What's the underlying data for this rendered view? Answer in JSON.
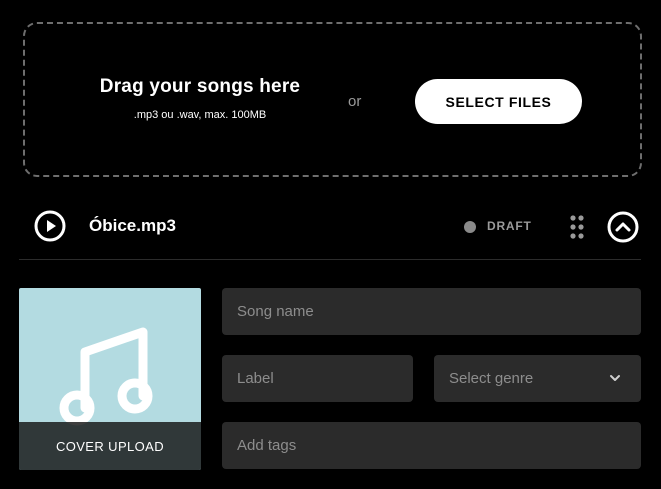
{
  "upload": {
    "title": "Drag your songs here",
    "subtitle": ".mp3 ou .wav, max. 100MB",
    "or_text": "or",
    "select_button": "SELECT FILES"
  },
  "track": {
    "name": "Óbice.mp3",
    "status": "DRAFT",
    "play_icon": "play-circle-icon",
    "drag_icon": "drag-handle-icon",
    "collapse_icon": "chevron-up-circle-icon"
  },
  "cover": {
    "label": "COVER UPLOAD",
    "icon": "music-note-icon",
    "bg_color": "#b3dbe1"
  },
  "form": {
    "song_name_placeholder": "Song name",
    "label_placeholder": "Label",
    "genre_placeholder": "Select genre",
    "tags_placeholder": "Add tags"
  },
  "colors": {
    "background": "#000000",
    "field_bg": "#2b2b2b",
    "status_dot": "#8a8a8a"
  }
}
